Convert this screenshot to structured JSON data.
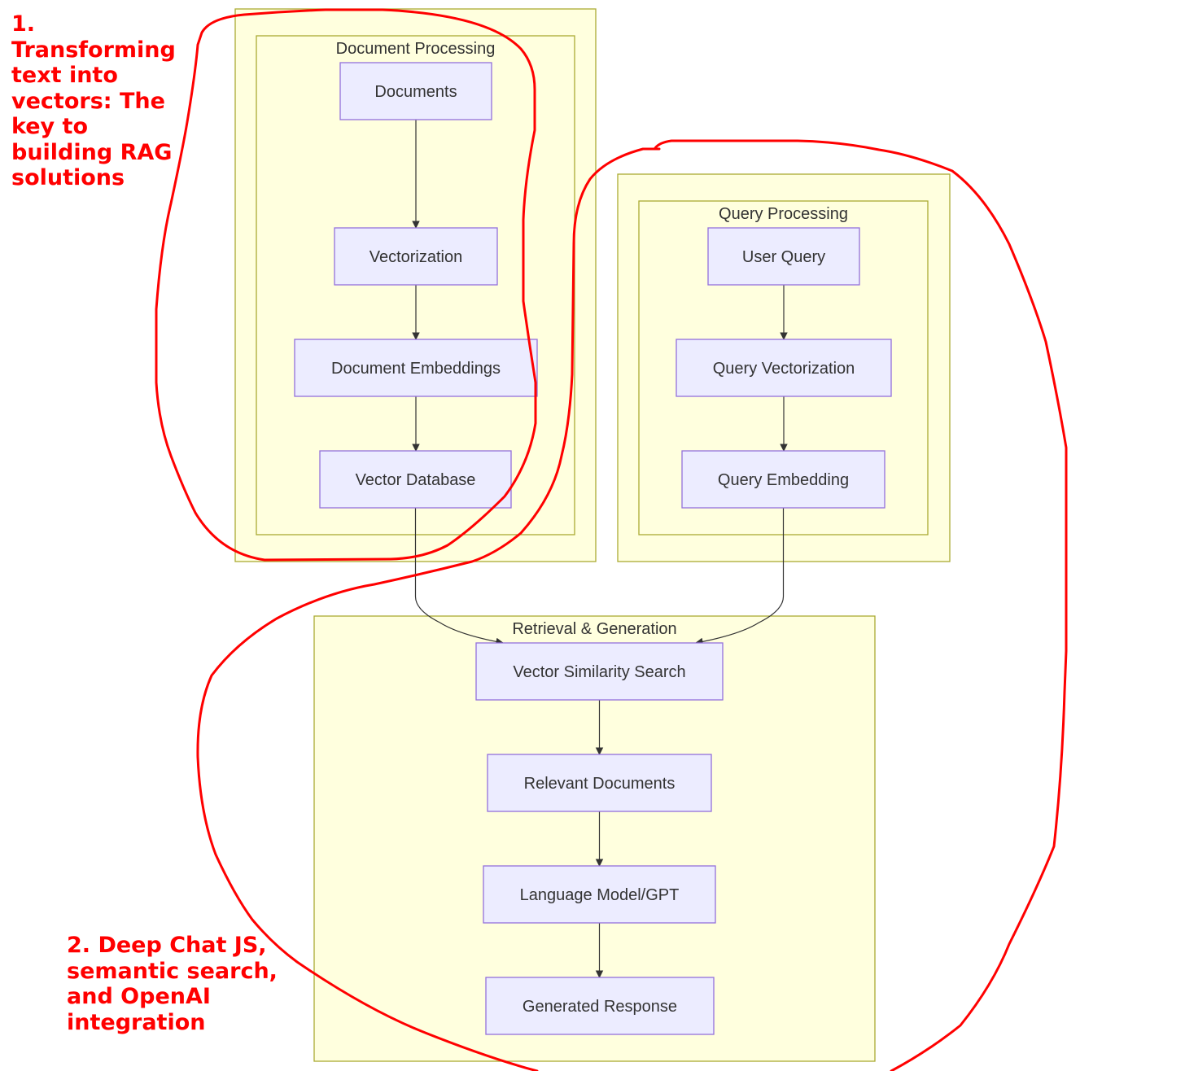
{
  "colors": {
    "cluster_fill": "#ffffde",
    "cluster_stroke": "#aaaa33",
    "node_fill": "#ececff",
    "node_stroke": "#9370db",
    "text": "#333333",
    "edge": "#333333",
    "annotation": "#ff0000"
  },
  "annotations": [
    "1. Transforming text into vectors: The key to building RAG solutions",
    "2. Deep Chat JS, semantic search, and OpenAI integration"
  ],
  "clusters": [
    {
      "id": "doc",
      "label": "Document Processing"
    },
    {
      "id": "query",
      "label": "Query Processing"
    },
    {
      "id": "rag",
      "label": "Retrieval & Generation"
    }
  ],
  "nodes": [
    {
      "id": "documents",
      "label": "Documents",
      "cluster": "doc"
    },
    {
      "id": "vectorization",
      "label": "Vectorization",
      "cluster": "doc"
    },
    {
      "id": "doc_embeddings",
      "label": "Document Embeddings",
      "cluster": "doc"
    },
    {
      "id": "vector_db",
      "label": "Vector Database",
      "cluster": "doc"
    },
    {
      "id": "user_query",
      "label": "User Query",
      "cluster": "query"
    },
    {
      "id": "query_vectorization",
      "label": "Query Vectorization",
      "cluster": "query"
    },
    {
      "id": "query_embedding",
      "label": "Query Embedding",
      "cluster": "query"
    },
    {
      "id": "similarity_search",
      "label": "Vector Similarity Search",
      "cluster": "rag"
    },
    {
      "id": "relevant_docs",
      "label": "Relevant Documents",
      "cluster": "rag"
    },
    {
      "id": "llm",
      "label": "Language Model/GPT",
      "cluster": "rag"
    },
    {
      "id": "response",
      "label": "Generated Response",
      "cluster": "rag"
    }
  ],
  "edges": [
    [
      "documents",
      "vectorization"
    ],
    [
      "vectorization",
      "doc_embeddings"
    ],
    [
      "doc_embeddings",
      "vector_db"
    ],
    [
      "user_query",
      "query_vectorization"
    ],
    [
      "query_vectorization",
      "query_embedding"
    ],
    [
      "vector_db",
      "similarity_search"
    ],
    [
      "query_embedding",
      "similarity_search"
    ],
    [
      "similarity_search",
      "relevant_docs"
    ],
    [
      "relevant_docs",
      "llm"
    ],
    [
      "llm",
      "response"
    ]
  ]
}
